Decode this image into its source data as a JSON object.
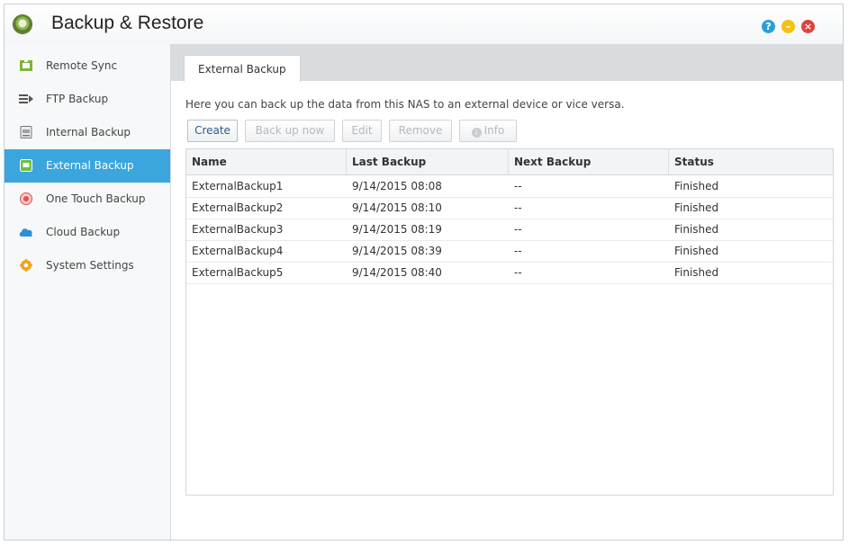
{
  "window": {
    "title": "Backup & Restore",
    "help_label": "?",
    "minimize_label": "–",
    "close_label": "×"
  },
  "sidebar": {
    "items": [
      {
        "label": "Remote Sync",
        "icon": "remote-sync-icon"
      },
      {
        "label": "FTP Backup",
        "icon": "ftp-backup-icon"
      },
      {
        "label": "Internal Backup",
        "icon": "internal-backup-icon"
      },
      {
        "label": "External Backup",
        "icon": "external-backup-icon",
        "active": true
      },
      {
        "label": "One Touch Backup",
        "icon": "one-touch-backup-icon"
      },
      {
        "label": "Cloud Backup",
        "icon": "cloud-icon"
      },
      {
        "label": "System Settings",
        "icon": "gear-icon"
      }
    ]
  },
  "main": {
    "tab_label": "External Backup",
    "description": "Here you can back up the data from this NAS to an external device or vice versa.",
    "toolbar": {
      "create": "Create",
      "back_up_now": "Back up now",
      "edit": "Edit",
      "remove": "Remove",
      "info": "Info"
    },
    "table": {
      "columns": [
        "Name",
        "Last Backup",
        "Next Backup",
        "Status"
      ],
      "rows": [
        [
          "ExternalBackup1",
          "9/14/2015 08:08",
          "--",
          "Finished"
        ],
        [
          "ExternalBackup2",
          "9/14/2015 08:10",
          "--",
          "Finished"
        ],
        [
          "ExternalBackup3",
          "9/14/2015 08:19",
          "--",
          "Finished"
        ],
        [
          "ExternalBackup4",
          "9/14/2015 08:39",
          "--",
          "Finished"
        ],
        [
          "ExternalBackup5",
          "9/14/2015 08:40",
          "--",
          "Finished"
        ]
      ]
    }
  },
  "colors": {
    "accent": "#3aa6dd",
    "help": "#2d9fd8",
    "minimize": "#f3c214",
    "close": "#e2413c"
  }
}
